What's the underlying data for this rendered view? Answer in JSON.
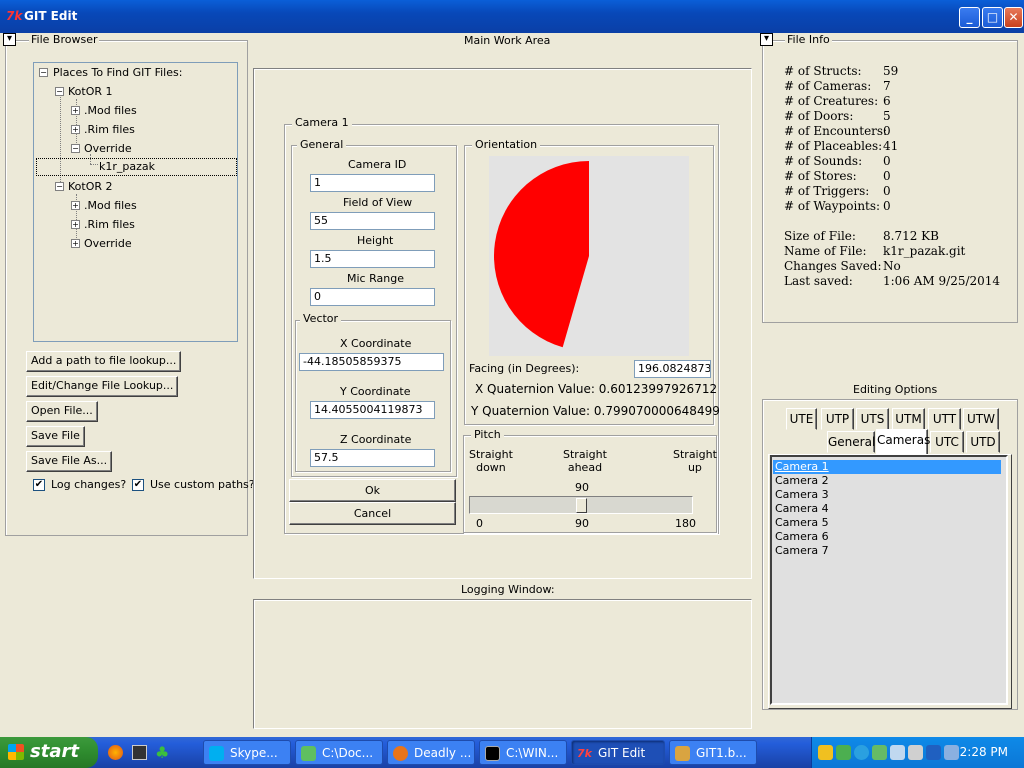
{
  "window": {
    "title": "GIT Edit",
    "app_icon": "7k"
  },
  "file_browser": {
    "title": "File Browser",
    "tree_root": "Places To Find GIT Files:",
    "kotor1": "KotOR 1",
    "k1_mod": ".Mod files",
    "k1_rim": ".Rim files",
    "k1_override": "Override",
    "k1_file": "k1r_pazak",
    "kotor2": "KotOR 2",
    "k2_mod": ".Mod files",
    "k2_rim": ".Rim files",
    "k2_override": "Override",
    "buttons": {
      "add_path": "Add a path to file lookup...",
      "edit_lookup": "Edit/Change File Lookup...",
      "open": "Open File...",
      "save": "Save File",
      "save_as": "Save File As..."
    },
    "log_changes": "Log changes?",
    "custom_paths": "Use custom paths?"
  },
  "main": {
    "title": "Main Work Area",
    "camera_group": "Camera 1",
    "general_group": "General",
    "camera_id_label": "Camera ID",
    "camera_id": "1",
    "fov_label": "Field of View",
    "fov": "55",
    "height_label": "Height",
    "height": "1.5",
    "mic_label": "Mic Range",
    "mic": "0",
    "vector_group": "Vector",
    "x_label": "X Coordinate",
    "x": "-44.18505859375",
    "y_label": "Y Coordinate",
    "y": "14.4055004119873",
    "z_label": "Z Coordinate",
    "z": "57.5",
    "ok": "Ok",
    "cancel": "Cancel",
    "orientation_group": "Orientation",
    "facing_label": "Facing (in Degrees):",
    "facing": "196.082487333",
    "facing_degrees": 196.08,
    "xq": "X Quaternion Value:  0.60123997926712",
    "yq": "Y Quaternion Value:  0.799070000648499",
    "pitch_group": "Pitch",
    "straight_down": "Straight\ndown",
    "straight_ahead": "Straight\nahead",
    "straight_up": "Straight\nup",
    "pitch_value": "90",
    "pitch_min": "0",
    "pitch_mid": "90",
    "pitch_max": "180",
    "pitch_fraction": 0.5,
    "pie_color": "#ff0000"
  },
  "logging": {
    "title": "Logging Window:"
  },
  "file_info": {
    "title": "File Info",
    "rows": [
      [
        "# of Structs:",
        "59"
      ],
      [
        "# of Cameras:",
        "7"
      ],
      [
        "# of Creatures:",
        "6"
      ],
      [
        "# of Doors:",
        "5"
      ],
      [
        "# of Encounters:",
        "0"
      ],
      [
        "# of Placeables:",
        "41"
      ],
      [
        "# of Sounds:",
        "0"
      ],
      [
        "# of Stores:",
        "0"
      ],
      [
        "# of Triggers:",
        "0"
      ],
      [
        "# of Waypoints:",
        "0"
      ]
    ],
    "size_label": "Size of File:",
    "size": "8.712 KB",
    "name_label": "Name of File:",
    "name": "k1r_pazak.git",
    "saved_label": "Changes Saved:",
    "saved": "No",
    "last_label": "Last saved:",
    "last": "1:06 AM  9/25/2014"
  },
  "editing": {
    "title": "Editing Options",
    "tabs_row1": [
      "UTE",
      "UTP",
      "UTS",
      "UTM",
      "UTT",
      "UTW"
    ],
    "tabs_row2": [
      "General",
      "Cameras",
      "UTC",
      "UTD"
    ],
    "cameras": [
      "Camera 1",
      "Camera 2",
      "Camera 3",
      "Camera 4",
      "Camera 5",
      "Camera 6",
      "Camera 7"
    ]
  },
  "taskbar": {
    "start": "start",
    "tasks": [
      "Skype...",
      "C:\\Doc...",
      "Deadly ...",
      "C:\\WIN...",
      "GIT Edit",
      "GIT1.b..."
    ],
    "clock": "2:28 PM"
  }
}
